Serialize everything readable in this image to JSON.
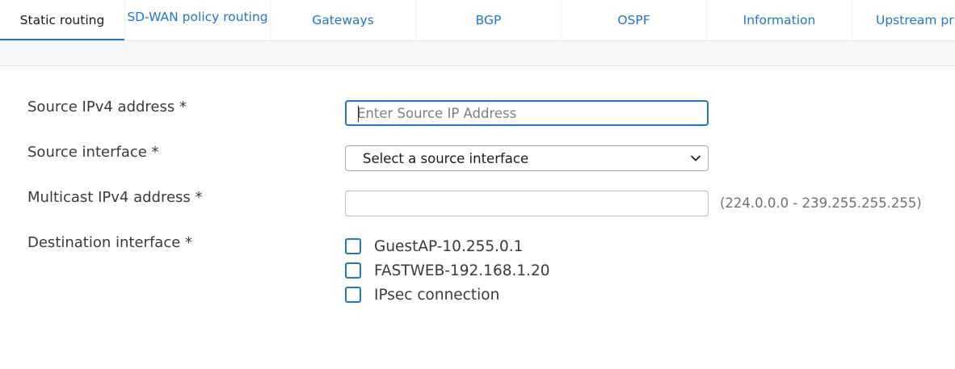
{
  "tabs": [
    {
      "label": "Static routing",
      "active": true
    },
    {
      "label": "SD-WAN policy routing",
      "active": false
    },
    {
      "label": "Gateways",
      "active": false
    },
    {
      "label": "BGP",
      "active": false
    },
    {
      "label": "OSPF",
      "active": false
    },
    {
      "label": "Information",
      "active": false
    },
    {
      "label": "Upstream pr",
      "active": false
    }
  ],
  "form": {
    "source_ip": {
      "label": "Source IPv4 address *",
      "placeholder": "Enter Source IP Address",
      "value": ""
    },
    "source_interface": {
      "label": "Source interface *",
      "selected": "Select a source interface"
    },
    "multicast_ip": {
      "label": "Multicast IPv4 address *",
      "value": "",
      "hint": "(224.0.0.0 - 239.255.255.255)"
    },
    "destination_interface": {
      "label": "Destination interface *",
      "options": [
        {
          "label": "GuestAP-10.255.0.1",
          "checked": false
        },
        {
          "label": "FASTWEB-192.168.1.20",
          "checked": false
        },
        {
          "label": "IPsec connection",
          "checked": false
        }
      ]
    }
  },
  "colors": {
    "accent": "#1f77c9",
    "label_text": "#3a3a3a",
    "hint_text": "#6d7176"
  }
}
